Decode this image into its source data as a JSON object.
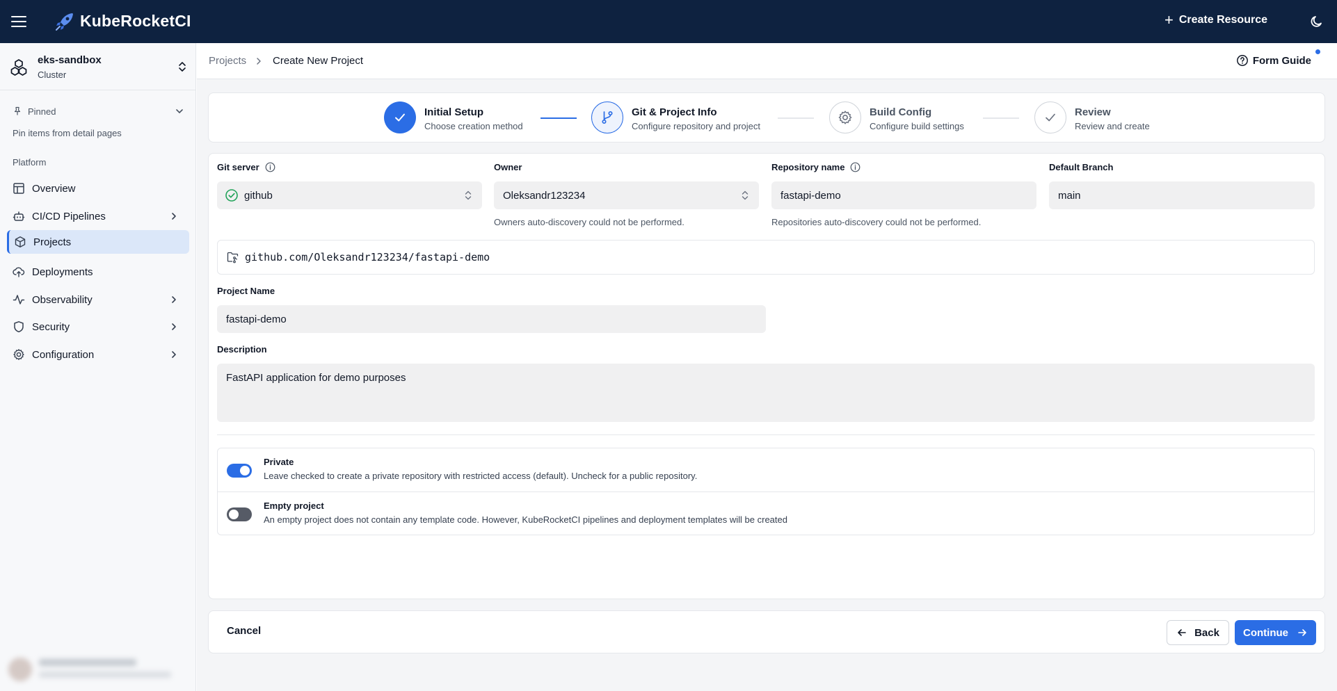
{
  "app": {
    "title": "KubeRocketCI"
  },
  "header": {
    "create_resource": "Create Resource"
  },
  "sidebar": {
    "cluster_name": "eks-sandbox",
    "cluster_label": "Cluster",
    "pinned_label": "Pinned",
    "pinned_hint": "Pin items from detail pages",
    "section_label": "Platform",
    "items": [
      {
        "label": "Overview"
      },
      {
        "label": "CI/CD Pipelines"
      },
      {
        "label": "Projects"
      },
      {
        "label": "Deployments"
      },
      {
        "label": "Observability"
      },
      {
        "label": "Security"
      },
      {
        "label": "Configuration"
      }
    ]
  },
  "breadcrumb": {
    "parent": "Projects",
    "current": "Create New Project"
  },
  "form_guide": "Form Guide",
  "stepper": {
    "steps": [
      {
        "title": "Initial Setup",
        "subtitle": "Choose creation method",
        "state": "done"
      },
      {
        "title": "Git & Project Info",
        "subtitle": "Configure repository and project",
        "state": "current"
      },
      {
        "title": "Build Config",
        "subtitle": "Configure build settings",
        "state": "todo"
      },
      {
        "title": "Review",
        "subtitle": "Review and create",
        "state": "todo"
      }
    ]
  },
  "form": {
    "git_server": {
      "label": "Git server",
      "value": "github"
    },
    "owner": {
      "label": "Owner",
      "value": "Oleksandr123234",
      "hint": "Owners auto-discovery could not be performed."
    },
    "repo_name": {
      "label": "Repository name",
      "value": "fastapi-demo",
      "hint": "Repositories auto-discovery could not be performed."
    },
    "default_branch": {
      "label": "Default Branch",
      "value": "main"
    },
    "repo_url": "github.com/Oleksandr123234/fastapi-demo",
    "project_name": {
      "label": "Project Name",
      "value": "fastapi-demo"
    },
    "description": {
      "label": "Description",
      "value": "FastAPI application for demo purposes"
    },
    "private": {
      "label": "Private",
      "description": "Leave checked to create a private repository with restricted access (default). Uncheck for a public repository.",
      "checked": true
    },
    "empty_project": {
      "label": "Empty project",
      "description": "An empty project does not contain any template code. However, KubeRocketCI pipelines and deployment templates will be created",
      "checked": false
    }
  },
  "footer": {
    "cancel": "Cancel",
    "back": "Back",
    "continue": "Continue"
  },
  "colors": {
    "topbar": "#0e2240",
    "accent": "#2b6de5",
    "success": "#22a35a"
  }
}
